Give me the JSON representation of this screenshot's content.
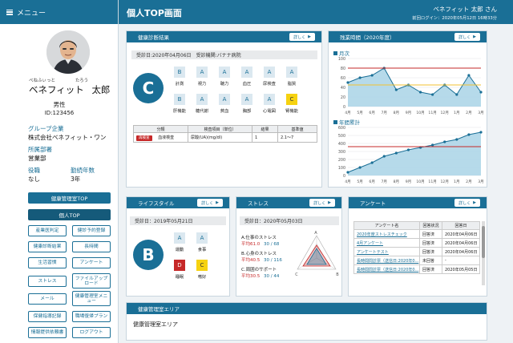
{
  "sidebar": {
    "menu_label": "メニュー",
    "ruby_last": "べねふぃっと",
    "ruby_first": "たろう",
    "last_name": "ベネフィット",
    "first_name": "太郎",
    "gender": "男性",
    "employee_id": "ID:123456",
    "group_label": "グループ企業",
    "group_value": "株式会社ベネフィット・ワン",
    "dept_label": "所属部署",
    "dept_value": "営業部",
    "position_label": "役職",
    "position_value": "なし",
    "tenure_label": "勤続年数",
    "tenure_value": "3年",
    "nav_top": "健康管理室TOP",
    "nav_personal": "個人TOP",
    "nav": [
      "産業医判定",
      "健診予約登録",
      "健康診断結果",
      "長時間",
      "生活習慣",
      "アンケート",
      "ストレス",
      "ファイルアップロード",
      "メール",
      "健康管理室メニュー",
      "保健指導記録",
      "職場復帰プラン",
      "情報提供依頼書",
      "ログアウト"
    ]
  },
  "header": {
    "title": "個人TOP画面",
    "user": "ベネフィット 太郎 さん",
    "last_login": "前回ログイン：2020年05月12日 16時33分"
  },
  "detail_label": "詳しく",
  "checkup": {
    "title": "健康診断結果",
    "date": "受診日:2020年04月06日",
    "facility": "受診機関:バナナ病院",
    "overall": "C",
    "grades": [
      {
        "grade": "B",
        "label": "計測",
        "color": "normal"
      },
      {
        "grade": "A",
        "label": "視力",
        "color": "normal"
      },
      {
        "grade": "A",
        "label": "聴力",
        "color": "normal"
      },
      {
        "grade": "A",
        "label": "血圧",
        "color": "normal"
      },
      {
        "grade": "A",
        "label": "尿検査",
        "color": "normal"
      },
      {
        "grade": "A",
        "label": "脂質",
        "color": "normal"
      },
      {
        "grade": "B",
        "label": "肝機能",
        "color": "normal"
      },
      {
        "grade": "A",
        "label": "糖代謝",
        "color": "normal"
      },
      {
        "grade": "A",
        "label": "貧血",
        "color": "normal"
      },
      {
        "grade": "A",
        "label": "胸部",
        "color": "normal"
      },
      {
        "grade": "A",
        "label": "心電図",
        "color": "normal"
      },
      {
        "grade": "C",
        "label": "腎機能",
        "color": "yellow"
      }
    ],
    "table": {
      "headers": [
        "分類",
        "検査項目（単位）",
        "結果",
        "基準値"
      ],
      "row": {
        "badge": "再検査",
        "category": "血液検査",
        "item": "尿酸(UA)(mg/dl)",
        "result": "1",
        "standard": "2.1〜7"
      }
    }
  },
  "overtime": {
    "title": "残業時間（2020年度）",
    "monthly_label": "月次",
    "annual_label": "年間累計",
    "colors": {
      "line": "#1a6f96",
      "fill": "#a9d3e6",
      "limit_red": "#c62828",
      "limit_yellow": "#f2c230"
    }
  },
  "chart_data": [
    {
      "type": "area",
      "title": "月次",
      "categories": [
        "4月",
        "5月",
        "6月",
        "7月",
        "8月",
        "9月",
        "10月",
        "11月",
        "12月",
        "1月",
        "2月",
        "3月"
      ],
      "series": [
        {
          "values": [
            50,
            60,
            65,
            80,
            35,
            45,
            30,
            25,
            45,
            25,
            65,
            30
          ]
        }
      ],
      "reference_lines": [
        {
          "value": 80,
          "color": "#c62828"
        },
        {
          "value": 45,
          "color": "#f2c230"
        }
      ],
      "yticks": [
        "100",
        "80",
        "60",
        "40",
        "20",
        "0"
      ],
      "ylim": [
        0,
        100
      ]
    },
    {
      "type": "area",
      "title": "年間累計",
      "categories": [
        "4月",
        "5月",
        "6月",
        "7月",
        "8月",
        "9月",
        "10月",
        "11月",
        "12月",
        "1月",
        "2月",
        "3月"
      ],
      "series": [
        {
          "values": [
            40,
            100,
            160,
            240,
            280,
            320,
            350,
            380,
            420,
            450,
            510,
            540
          ]
        }
      ],
      "reference_lines": [
        {
          "value": 360,
          "color": "#c62828"
        }
      ],
      "yticks": [
        "600",
        "500",
        "400",
        "300",
        "200",
        "100",
        "0"
      ],
      "ylim": [
        0,
        600
      ]
    }
  ],
  "lifestyle": {
    "title": "ライフスタイル",
    "date": "受診日：2019年05月21日",
    "overall": "B",
    "grades": [
      {
        "grade": "A",
        "label": "運動",
        "color": "normal"
      },
      {
        "grade": "A",
        "label": "食事",
        "color": "normal"
      },
      {
        "grade": "D",
        "label": "睡眠",
        "color": "red"
      },
      {
        "grade": "C",
        "label": "嗜好",
        "color": "yellow"
      }
    ]
  },
  "stress": {
    "title": "ストレス",
    "date": "受診日：2020年05月03日",
    "items": [
      {
        "label": "A.仕事のストレス",
        "avg_label": "平均61.0",
        "score": "30 / 68"
      },
      {
        "label": "B.心身のストレス",
        "avg_label": "平均40.5",
        "score": "30 / 116"
      },
      {
        "label": "C.周囲のサポート",
        "avg_label": "平均30.5",
        "score": "30 / 44"
      }
    ],
    "axes": [
      "A",
      "B",
      "C"
    ]
  },
  "survey": {
    "title": "アンケート",
    "headers": [
      "アンケート名",
      "回答状況",
      "回答日"
    ],
    "rows": [
      {
        "name": "2020年度ストレスチェック",
        "status": "回答済",
        "date": "2020年04月06日"
      },
      {
        "name": "4月アンケート",
        "status": "回答済",
        "date": "2020年04月06日"
      },
      {
        "name": "アンケートテスト",
        "status": "回答済",
        "date": "2020年04月06日"
      },
      {
        "name": "長時間問診票（送信日:2020年0...",
        "status": "未回答",
        "date": "-"
      },
      {
        "name": "長時間問診票（送信日:2020年0...",
        "status": "回答済",
        "date": "2020年05月05日"
      }
    ]
  },
  "area": {
    "title": "健康管理室エリア",
    "body": "健康管理室エリア"
  }
}
